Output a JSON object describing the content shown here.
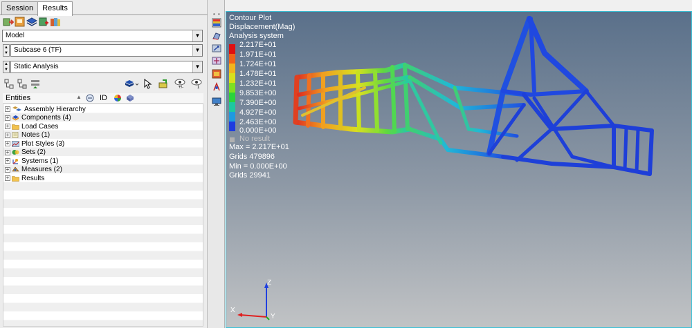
{
  "tabs": [
    {
      "label": "Session"
    },
    {
      "label": "Results"
    }
  ],
  "selects": {
    "model": "Model",
    "subcase": "Subcase 6 (TF)",
    "analysis": "Static Analysis"
  },
  "browser": {
    "header": "Entities",
    "id_label": "ID",
    "items": [
      {
        "label": "Assembly Hierarchy"
      },
      {
        "label": "Components (4)"
      },
      {
        "label": "Load Cases"
      },
      {
        "label": "Notes (1)"
      },
      {
        "label": "Plot Styles (3)"
      },
      {
        "label": "Sets  (2)"
      },
      {
        "label": "Systems (1)"
      },
      {
        "label": "Measures (2)"
      },
      {
        "label": "Results"
      }
    ]
  },
  "legend": {
    "title1": "Contour Plot",
    "title2": "Displacement(Mag)",
    "title3": "Analysis system",
    "levels": [
      {
        "value": "2.217E+01",
        "color": "#e01010"
      },
      {
        "value": "1.971E+01",
        "color": "#f0641a"
      },
      {
        "value": "1.724E+01",
        "color": "#f0b41e"
      },
      {
        "value": "1.478E+01",
        "color": "#d8e01c"
      },
      {
        "value": "1.232E+01",
        "color": "#7ee022"
      },
      {
        "value": "9.853E+00",
        "color": "#2ad43c"
      },
      {
        "value": "7.390E+00",
        "color": "#1ec8a0"
      },
      {
        "value": "4.927E+00",
        "color": "#1e9ae0"
      },
      {
        "value": "2.463E+00",
        "color": "#1e3ce0"
      },
      {
        "value": "0.000E+00",
        "color": ""
      }
    ],
    "no_result": "No result",
    "max_line": "Max = 2.217E+01",
    "max_grid": "Grids 479896",
    "min_line": "Min = 0.000E+00",
    "min_grid": "Grids 29941"
  },
  "axes": {
    "x": "X",
    "y": "Y",
    "z": "Z"
  }
}
